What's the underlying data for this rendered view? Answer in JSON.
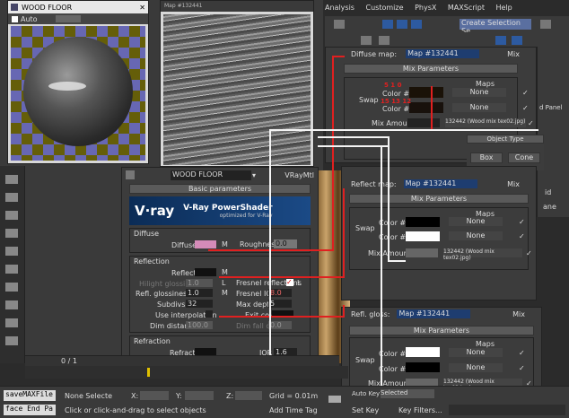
{
  "material_editor": {
    "title": "WOOD FLOOR",
    "auto_label": "Auto",
    "material_name": "WOOD FLOOR",
    "material_type": "VRayMtl",
    "basic_params_title": "Basic parameters",
    "vray_logo": "V·ray",
    "vray_title": "V-Ray PowerShader",
    "vray_subtitle": "optimized for V-Ray",
    "diffuse_section": "Diffuse",
    "diffuse_label": "Diffuse",
    "roughness_label": "Roughness",
    "roughness_value": "0.0",
    "reflection_section": "Reflection",
    "reflect_label": "Reflect",
    "hilight_gloss_label": "Hilight glossiness",
    "hilight_value": "1.0",
    "refl_gloss_label": "Refl. glossiness",
    "refl_gloss_value": "1.0",
    "subdivs_label": "Subdivs",
    "subdivs_value": "32",
    "use_interp_label": "Use interpolation",
    "dim_distance_label": "Dim distance",
    "dim_distance_value": "100.0",
    "fresnel_reflections_label": "Fresnel reflections",
    "fresnel_ior_label": "Fresnel IOR",
    "fresnel_ior_value": "8.0",
    "max_depth_label": "Max depth",
    "max_depth_value": "5",
    "exit_color_label": "Exit color",
    "dim_falloff_label": "Dim fall off",
    "dim_falloff_value": "0.0",
    "refraction_section": "Refraction",
    "refract_label": "Refract",
    "ior_label": "IOR",
    "ior_value": "1.6",
    "l_label": "L",
    "m_label": "M"
  },
  "preview_window": {
    "title": "Map #132441"
  },
  "menu": [
    "Analysis",
    "Customize",
    "PhysX",
    "MAXScript",
    "Help"
  ],
  "top_dropdown": "Create Selection Se",
  "diffuse_map_panel": {
    "label": "Diffuse map:",
    "map_name": "Map #132441",
    "map_type": "Mix",
    "params_title": "Mix Parameters",
    "maps_header": "Maps",
    "swap_label": "Swap",
    "color1_label": "Color #1",
    "color2_label": "Color #2",
    "color1_value": "None",
    "color2_value": "None",
    "mix_amount_label": "Mix Amount:",
    "mix_amount_value": "132442 (Wood mix tex02.jpg)",
    "annot_rgb1": "5 1 0",
    "annot_rgb2": "15 13 12"
  },
  "reflect_map_panel": {
    "label": "Reflect map:",
    "map_name": "Map #132441",
    "map_type": "Mix",
    "params_title": "Mix Parameters",
    "maps_header": "Maps",
    "swap_label": "Swap",
    "color1_label": "Color #1",
    "color2_label": "Color #2",
    "color1_value": "None",
    "color2_value": "None",
    "mix_amount_label": "Mix Amount:",
    "mix_amount_value": "132442 (Wood mix tex02.jpg)"
  },
  "refl_gloss_panel": {
    "label": "Refl. gloss:",
    "map_name": "Map #132441",
    "map_type": "Mix",
    "params_title": "Mix Parameters",
    "maps_header": "Maps",
    "swap_label": "Swap",
    "color1_label": "Color #1",
    "color2_label": "Color #2",
    "color1_value": "None",
    "color2_value": "None",
    "mix_amount_label": "Mix Amount:",
    "mix_amount_value": "132442 (Wood mix tex02.jpg)"
  },
  "right_panel": {
    "d_panel": "d Panel",
    "object_type": "Object Type",
    "box": "Box",
    "cone": "Cone",
    "misc1": "id",
    "misc2": "ane"
  },
  "status": {
    "script1": "saveMAXFile",
    "script2": "face End Pa",
    "none_selected": "None Selecte",
    "x_label": "X:",
    "y_label": "Y:",
    "z_label": "Z:",
    "grid": "Grid = 0.01m",
    "prompt": "Click or click-and-drag to select objects",
    "add_time_tag": "Add Time Tag",
    "set_key": "Set Key",
    "key_filters": "Key Filters...",
    "auto_key": "Auto Key",
    "selected": "Selected",
    "frame": "0 / 1"
  }
}
